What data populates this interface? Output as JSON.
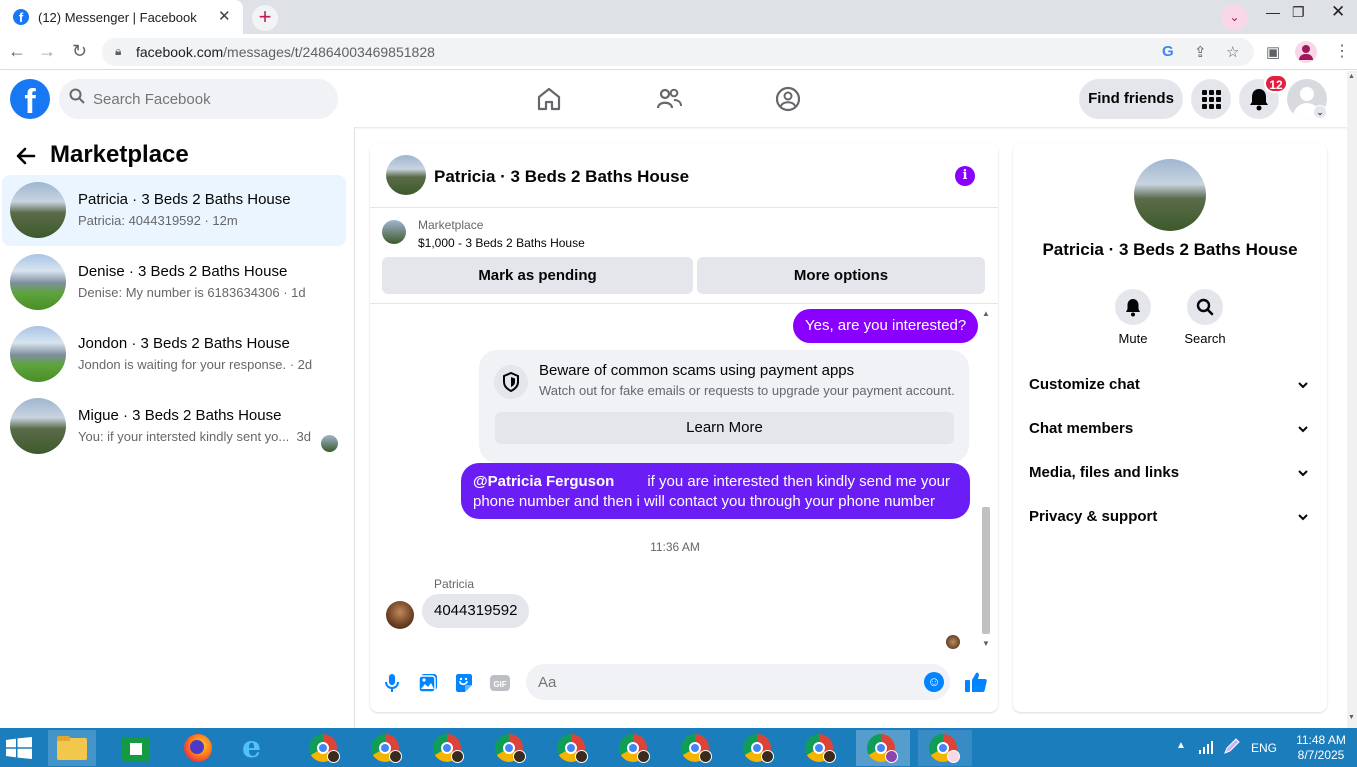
{
  "browser": {
    "tab_title": "(12) Messenger | Facebook",
    "url_domain": "facebook.com",
    "url_path": "/messages/t/24864003469851828"
  },
  "header": {
    "search_placeholder": "Search Facebook",
    "find_friends": "Find friends",
    "notification_count": "12"
  },
  "sidebar": {
    "title": "Marketplace",
    "conversations": [
      {
        "name": "Patricia · 3 Beds 2 Baths House",
        "preview": "Patricia: 4044319592 · 12m"
      },
      {
        "name": "Denise · 3 Beds 2 Baths House",
        "preview": "Denise: My number is 6183634306 · 1d"
      },
      {
        "name": "Jondon · 3 Beds 2 Baths House",
        "preview": "Jondon is waiting for your response. · 2d"
      },
      {
        "name": "Migue · 3 Beds 2 Baths House",
        "preview": "You: if your intersted kindly sent yo...",
        "time": "3d"
      }
    ]
  },
  "chat": {
    "title": "Patricia · 3 Beds 2 Baths House",
    "listing_label": "Marketplace",
    "listing_price": "$1,000 - 3 Beds 2 Baths House",
    "mark_pending": "Mark as pending",
    "more_options": "More options",
    "messages": {
      "out1": "Yes, are you interested?",
      "scam_title": "Beware of common scams using payment apps",
      "scam_text": "Watch out for fake emails or requests to upgrade your payment account.",
      "learn_more": "Learn More",
      "out2_mention": "@Patricia Ferguson",
      "out2_line1": "if you are interested then kindly send me your",
      "out2_line2": "phone number and then i will contact you through your phone number",
      "timestamp": "11:36 AM",
      "sender": "Patricia",
      "in1": "4044319592"
    },
    "input_placeholder": "Aa"
  },
  "details": {
    "name": "Patricia · 3 Beds 2 Baths House",
    "mute": "Mute",
    "search": "Search",
    "sections": [
      "Customize chat",
      "Chat members",
      "Media, files and links",
      "Privacy & support"
    ]
  },
  "taskbar": {
    "lang": "ENG",
    "time": "11:48 AM",
    "date": "8/7/2025"
  },
  "colors": {
    "accent": "#8a00ff",
    "fb_blue": "#1877f2",
    "selected_row": "#ebf5ff",
    "taskbar": "#1c7dbd"
  }
}
